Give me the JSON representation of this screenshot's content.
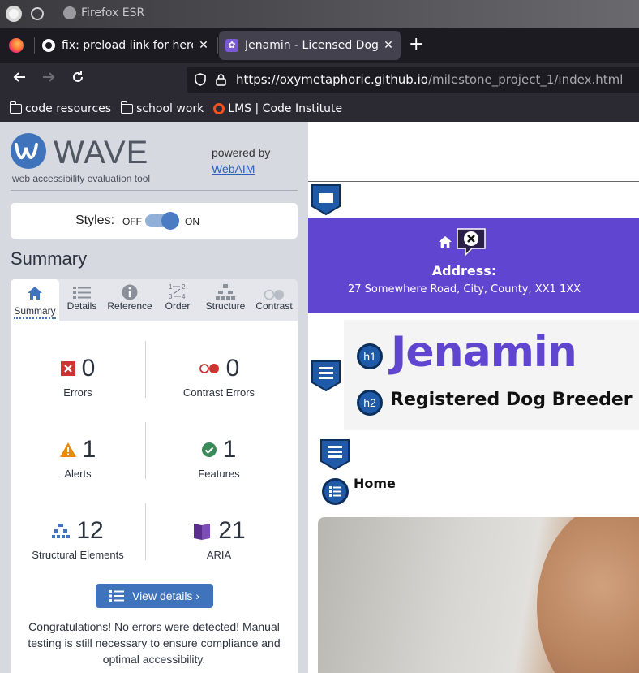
{
  "window": {
    "title": "Firefox ESR"
  },
  "tabs": [
    {
      "label": "fix: preload link for hero-i",
      "close": "✕"
    },
    {
      "label": "Jenamin - Licensed Dog B",
      "close": "✕"
    }
  ],
  "new_tab": "+",
  "nav": {
    "url_host": "https://oxymetaphoric.github.io",
    "url_path": "/milestone_project_1/index.html"
  },
  "bookmarks": [
    {
      "label": "code resources",
      "icon": "folder-icon"
    },
    {
      "label": "school work",
      "icon": "folder-icon"
    },
    {
      "label": "LMS | Code Institute",
      "icon": "lms-icon"
    }
  ],
  "wave": {
    "logo_text": "WAVE",
    "subtitle": "web accessibility evaluation tool",
    "powered_by": "powered by",
    "webaim": "WebAIM",
    "styles_label": "Styles:",
    "styles_off": "OFF",
    "styles_on": "ON",
    "styles_enabled": true,
    "summary_heading": "Summary",
    "tabs": [
      {
        "label": "Summary",
        "icon": "home-icon",
        "active": true
      },
      {
        "label": "Details",
        "icon": "list-icon",
        "active": false
      },
      {
        "label": "Reference",
        "icon": "info-icon",
        "active": false
      },
      {
        "label": "Order",
        "icon": "order-icon",
        "active": false
      },
      {
        "label": "Structure",
        "icon": "structure-icon",
        "active": false
      },
      {
        "label": "Contrast",
        "icon": "contrast-icon",
        "active": false
      }
    ],
    "stats": {
      "errors": {
        "count": "0",
        "label": "Errors"
      },
      "contrast": {
        "count": "0",
        "label": "Contrast Errors"
      },
      "alerts": {
        "count": "1",
        "label": "Alerts"
      },
      "features": {
        "count": "1",
        "label": "Features"
      },
      "structural": {
        "count": "12",
        "label": "Structural Elements"
      },
      "aria": {
        "count": "21",
        "label": "ARIA"
      }
    },
    "view_details": "View details ›",
    "congrats": "Congratulations! No errors were detected! Manual testing is still necessary to ensure compliance and optimal accessibility."
  },
  "site": {
    "address_label": "Address:",
    "address_value": "27 Somewhere Road, City, County, XX1 1XX",
    "h1_badge": "h1",
    "h2_badge": "h2",
    "brand": "Jenamin",
    "tagline": "Registered Dog Breeder",
    "nav_home": "Home"
  },
  "colors": {
    "wave_blue": "#3f73bb",
    "site_purple": "#5f45d0",
    "error_red": "#c33",
    "alert_orange": "#e8890c",
    "feature_green": "#3a8a5a"
  }
}
